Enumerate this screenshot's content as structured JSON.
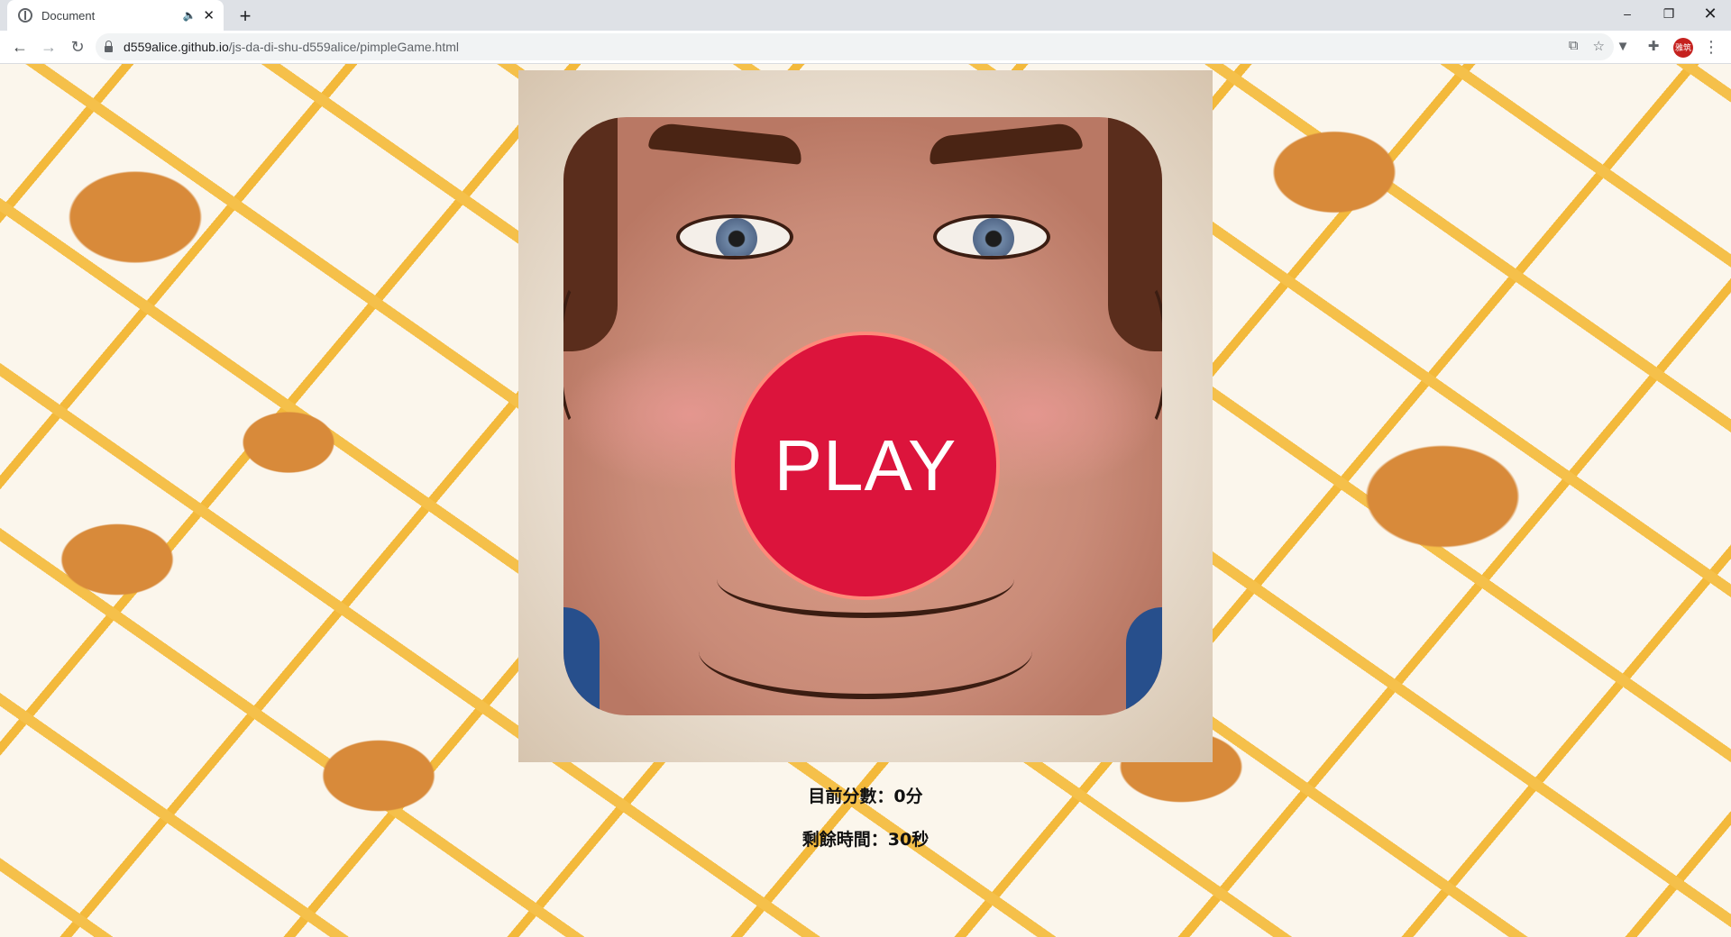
{
  "browser": {
    "tab": {
      "title": "Document",
      "audio_icon": "speaker-icon",
      "close_icon": "close-icon"
    },
    "new_tab_label": "+",
    "window_controls": {
      "minimize": "–",
      "maximize": "❐",
      "close": "✕"
    },
    "url": {
      "host": "d559alice.github.io",
      "path": "/js-da-di-shu-d559alice/pimpleGame.html"
    },
    "profile_initials": "雅筑"
  },
  "game": {
    "play_label": "PLAY",
    "score_text": "目前分數：0分",
    "time_text": "剩餘時間：30秒"
  },
  "colors": {
    "play_button": "#dc143c",
    "play_border": "#ff8a7a",
    "page_background": "#fbf6ec"
  }
}
